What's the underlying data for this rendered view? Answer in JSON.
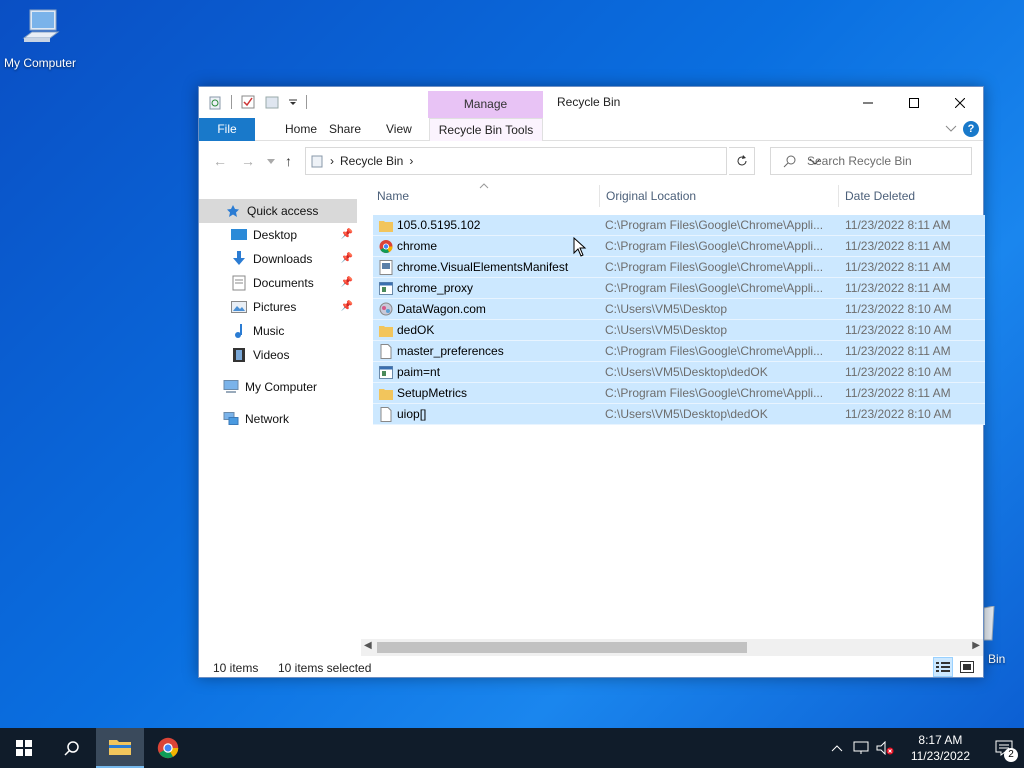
{
  "desktop": {
    "my_computer_label": "My Computer",
    "recycle_bin_partial_label": "Bin"
  },
  "window": {
    "title": "Recycle Bin",
    "manage_tab": "Manage",
    "ribbon": {
      "file": "File",
      "home": "Home",
      "share": "Share",
      "view": "View",
      "tools": "Recycle Bin Tools"
    },
    "address": {
      "crumb": "Recycle Bin"
    },
    "search_placeholder": "Search Recycle Bin",
    "sidebar": {
      "items": [
        {
          "label": "Quick access",
          "icon": "star-icon"
        },
        {
          "label": "Desktop",
          "icon": "desktop-folder-icon",
          "pinned": true
        },
        {
          "label": "Downloads",
          "icon": "download-arrow-icon",
          "pinned": true
        },
        {
          "label": "Documents",
          "icon": "document-icon",
          "pinned": true
        },
        {
          "label": "Pictures",
          "icon": "pictures-icon",
          "pinned": true
        },
        {
          "label": "Music",
          "icon": "music-note-icon"
        },
        {
          "label": "Videos",
          "icon": "film-icon"
        },
        {
          "label": "My Computer",
          "icon": "computer-icon"
        },
        {
          "label": "Network",
          "icon": "network-icon"
        }
      ]
    },
    "columns": {
      "name": "Name",
      "original_location": "Original Location",
      "date_deleted": "Date Deleted"
    },
    "files": [
      {
        "name": "105.0.5195.102",
        "location": "C:\\Program Files\\Google\\Chrome\\Appli...",
        "date": "11/23/2022 8:11 AM",
        "icon": "folder-icon"
      },
      {
        "name": "chrome",
        "location": "C:\\Program Files\\Google\\Chrome\\Appli...",
        "date": "11/23/2022 8:11 AM",
        "icon": "chrome-icon"
      },
      {
        "name": "chrome.VisualElementsManifest",
        "location": "C:\\Program Files\\Google\\Chrome\\Appli...",
        "date": "11/23/2022 8:11 AM",
        "icon": "manifest-file-icon"
      },
      {
        "name": "chrome_proxy",
        "location": "C:\\Program Files\\Google\\Chrome\\Appli...",
        "date": "11/23/2022 8:11 AM",
        "icon": "exe-file-icon"
      },
      {
        "name": "DataWagon.com",
        "location": "C:\\Users\\VM5\\Desktop",
        "date": "11/23/2022 8:10 AM",
        "icon": "com-file-icon"
      },
      {
        "name": "dedOK",
        "location": "C:\\Users\\VM5\\Desktop",
        "date": "11/23/2022 8:10 AM",
        "icon": "folder-icon"
      },
      {
        "name": "master_preferences",
        "location": "C:\\Program Files\\Google\\Chrome\\Appli...",
        "date": "11/23/2022 8:11 AM",
        "icon": "blank-file-icon"
      },
      {
        "name": "paim=nt",
        "location": "C:\\Users\\VM5\\Desktop\\dedOK",
        "date": "11/23/2022 8:10 AM",
        "icon": "exe-file-icon"
      },
      {
        "name": "SetupMetrics",
        "location": "C:\\Program Files\\Google\\Chrome\\Appli...",
        "date": "11/23/2022 8:11 AM",
        "icon": "folder-icon"
      },
      {
        "name": "uiop[]",
        "location": "C:\\Users\\VM5\\Desktop\\dedOK",
        "date": "11/23/2022 8:10 AM",
        "icon": "blank-file-icon"
      }
    ],
    "status": {
      "count": "10 items",
      "selected": "10 items selected"
    }
  },
  "taskbar": {
    "time": "8:17 AM",
    "date": "11/23/2022",
    "notification_count": "2"
  },
  "colors": {
    "selection": "#cce8ff",
    "file_tab": "#1979ca",
    "manage_tab": "#e8c3f5",
    "taskbar": "#101c2a"
  }
}
